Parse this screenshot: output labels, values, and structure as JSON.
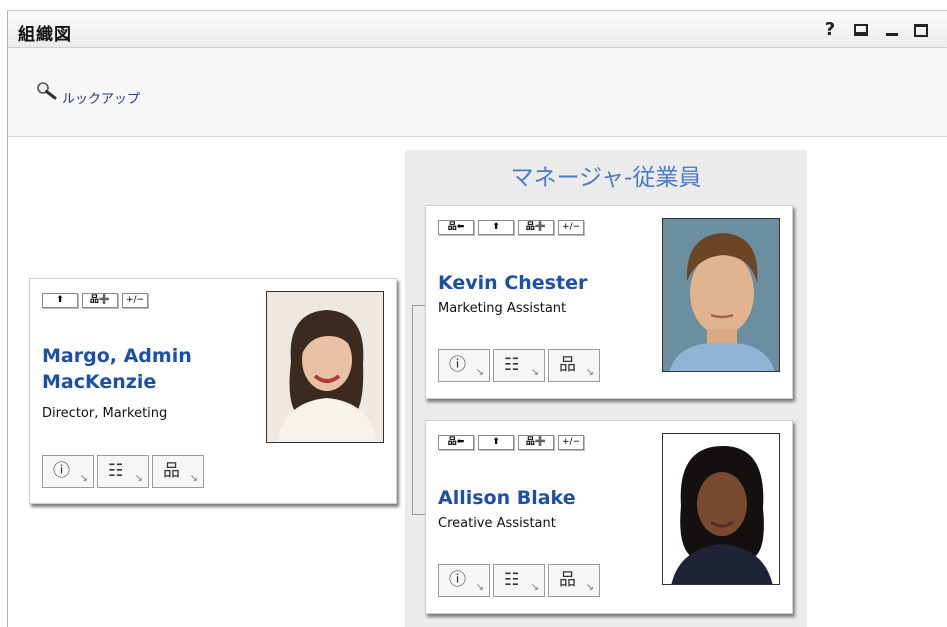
{
  "header": {
    "title": "組織図",
    "help_label": "?"
  },
  "toolbar": {
    "lookup_label": "ルックアップ"
  },
  "panel": {
    "title": "マネージャ-従業員"
  },
  "root_person": {
    "name_line1": "Margo, Admin",
    "name_line2": "MacKenzie",
    "title": "Director, Marketing",
    "buttons": [
      "⬆",
      "品➕",
      "+/−"
    ]
  },
  "employees": [
    {
      "name": "Kevin Chester",
      "title": "Marketing Assistant",
      "buttons": [
        "品⬅",
        "⬆",
        "品➕",
        "+/−"
      ]
    },
    {
      "name": "Allison Blake",
      "title": "Creative Assistant",
      "buttons": [
        "品⬅",
        "⬆",
        "品➕",
        "+/−"
      ]
    }
  ],
  "card_icons": {
    "info": "ⓘ",
    "mail": "☷",
    "org": "品",
    "expand": "↘"
  },
  "colors": {
    "name_blue": "#1b4fa8",
    "panel_title_blue": "#4a7cc8",
    "panel_bg": "#ebebeb"
  }
}
